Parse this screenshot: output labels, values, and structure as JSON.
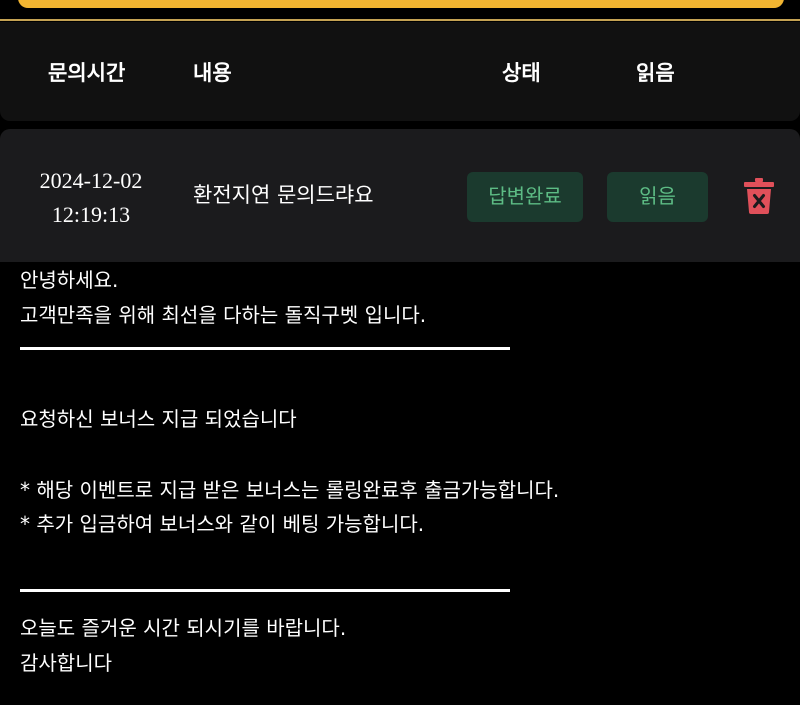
{
  "table": {
    "headers": {
      "time": "문의시간",
      "content": "내용",
      "status": "상태",
      "read": "읽음"
    },
    "rows": [
      {
        "date": "2024-12-02",
        "time": "12:19:13",
        "subject": "환전지연 문의드랴요",
        "status": "답변완료",
        "read": "읽음",
        "delete_icon": "trash-icon"
      }
    ]
  },
  "reply": {
    "greeting": "안녕하세요.",
    "intro": "고객만족을 위해 최선을 다하는 돌직구벳 입니다.",
    "notice": "요청하신 보너스 지급 되었습니다",
    "bullets": [
      "* 해당 이벤트로 지급 받은 보너스는 롤링완료후 출금가능합니다.",
      "* 추가 입금하여 보너스와 같이 베팅 가능합니다."
    ],
    "closing": "오늘도 즐거운 시간 되시기를 바랍니다.",
    "thanks": "감사합니다"
  },
  "colors": {
    "accent": "#f2b531",
    "gold_line": "#c4a253",
    "badge_text": "#5dbc85",
    "badge_bg": "#1b3a2e",
    "delete": "#e0505a"
  }
}
